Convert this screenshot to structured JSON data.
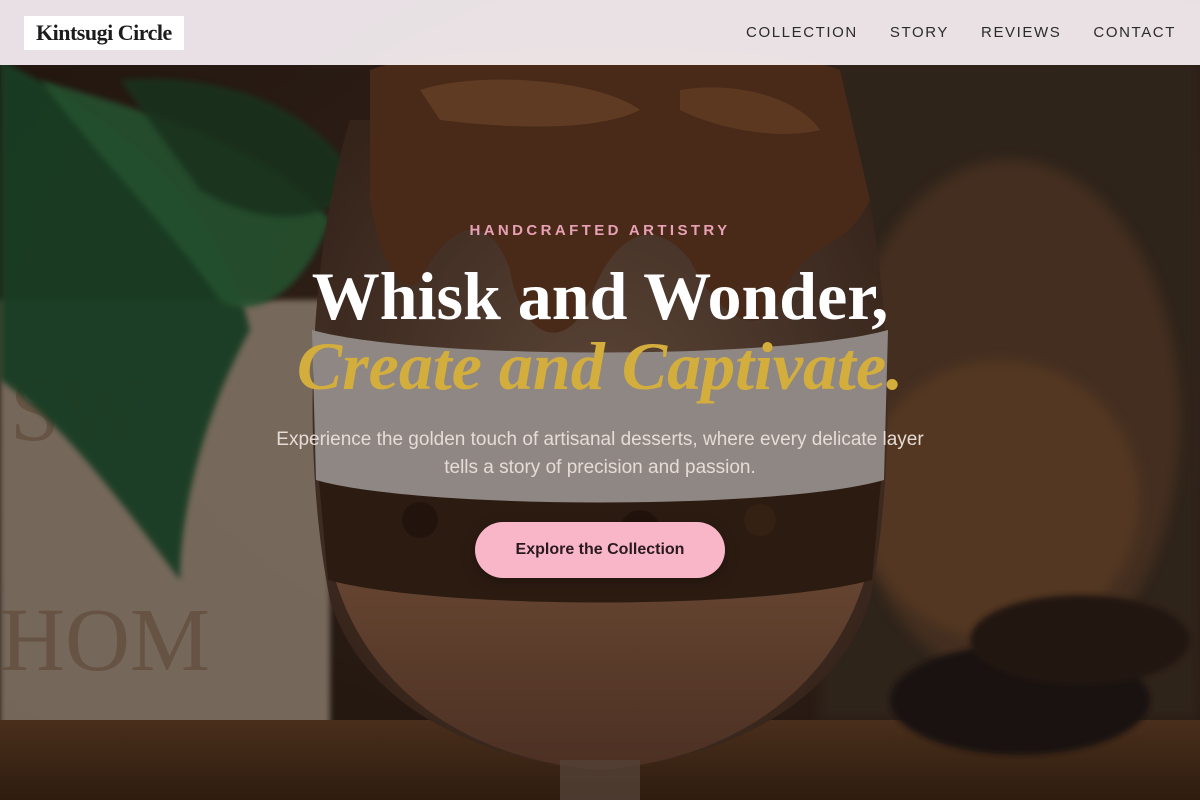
{
  "brand": {
    "name": "Kintsugi Circle"
  },
  "nav": {
    "links": [
      {
        "label": "COLLECTION"
      },
      {
        "label": "STORY"
      },
      {
        "label": "REVIEWS"
      },
      {
        "label": "CONTACT"
      }
    ]
  },
  "hero": {
    "eyebrow": "HANDCRAFTED ARTISTRY",
    "headline_line1": "Whisk and Wonder,",
    "headline_line2": "Create and Captivate.",
    "description": "Experience the golden touch of artisanal desserts, where every delicate layer tells a story of precision and passion.",
    "cta_label": "Explore the Collection"
  },
  "colors": {
    "accent_pink": "#f9b6c9",
    "eyebrow_pink": "#e8a1b4",
    "gold": "#d4ae3d",
    "nav_bg": "#f8f0f4"
  }
}
